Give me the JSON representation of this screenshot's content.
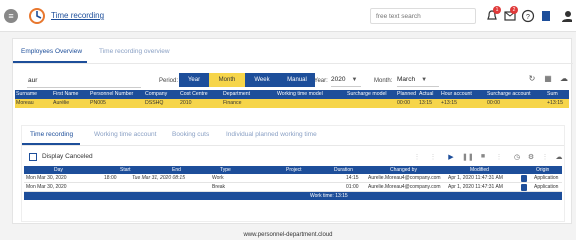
{
  "topbar": {
    "app_title": "Time recording",
    "search_placeholder": "free text search",
    "badge_count_1": "1",
    "badge_count_2": "2"
  },
  "tabs": [
    {
      "label": "Employees Overview"
    },
    {
      "label": "Time recording overview"
    }
  ],
  "filter": {
    "user_value": "aur",
    "period_label": "Period:",
    "period_buttons": [
      "Year",
      "Month",
      "Week",
      "Manual"
    ],
    "year_label": "Year:",
    "year_value": "2020",
    "month_label": "Month:",
    "month_value": "March"
  },
  "employees": {
    "headers": [
      "Surname",
      "First Name",
      "Personnel Number",
      "Company",
      "Cost Centre",
      "Department",
      "Working time model",
      "Surcharge model",
      "Planned",
      "Actual",
      "Hour account",
      "Surcharge account",
      "Sum"
    ],
    "rows": [
      [
        "Moreau",
        "Aurélie",
        "PN005",
        "DSSHQ",
        "2010",
        "Finance",
        "",
        "",
        "00:00",
        "13:15",
        "+13:15",
        "00:00",
        "+13:15"
      ]
    ]
  },
  "subtabs": [
    {
      "label": "Time recording"
    },
    {
      "label": "Working time account"
    },
    {
      "label": "Booking cuts"
    },
    {
      "label": "Individual planned working time"
    }
  ],
  "display_canceled": "Display Canceled",
  "records": {
    "headers": [
      "Day",
      "Start",
      "End",
      "Type",
      "Project",
      "Duration",
      "Changed by",
      "Modified",
      "",
      "Origin"
    ],
    "rows": [
      [
        "Mon Mar 30, 2020",
        "18:00",
        "Tue Mar 31, 2020 08:15",
        "Work",
        "",
        "14:15",
        "Aurelie.Moreau4@company.com",
        "Apr 1, 2020 11:47:31 AM",
        "",
        "Application"
      ],
      [
        "Mon Mar 30, 2020",
        "",
        "",
        "Break",
        "",
        "01:00",
        "Aurelie.Moreau4@company.com",
        "Apr 1, 2020 11:47:31 AM",
        "",
        "Application"
      ]
    ],
    "footer": "Work time: 13:15"
  },
  "footer_url": "www.personnel-department.cloud",
  "colors": {
    "brand_blue": "#1d4e9a",
    "highlight_yellow": "#f6d54a",
    "badge_red": "#e03a3a"
  },
  "icons": [
    "menu-icon",
    "app-logo-icon",
    "notifications-icon",
    "messages-icon",
    "help-icon",
    "book-icon",
    "user-icon",
    "refresh-icon",
    "list-icon",
    "cloud-icon",
    "play-icon",
    "pause-icon",
    "stop-icon",
    "clock-icon",
    "settings-icon",
    "trash-icon"
  ]
}
